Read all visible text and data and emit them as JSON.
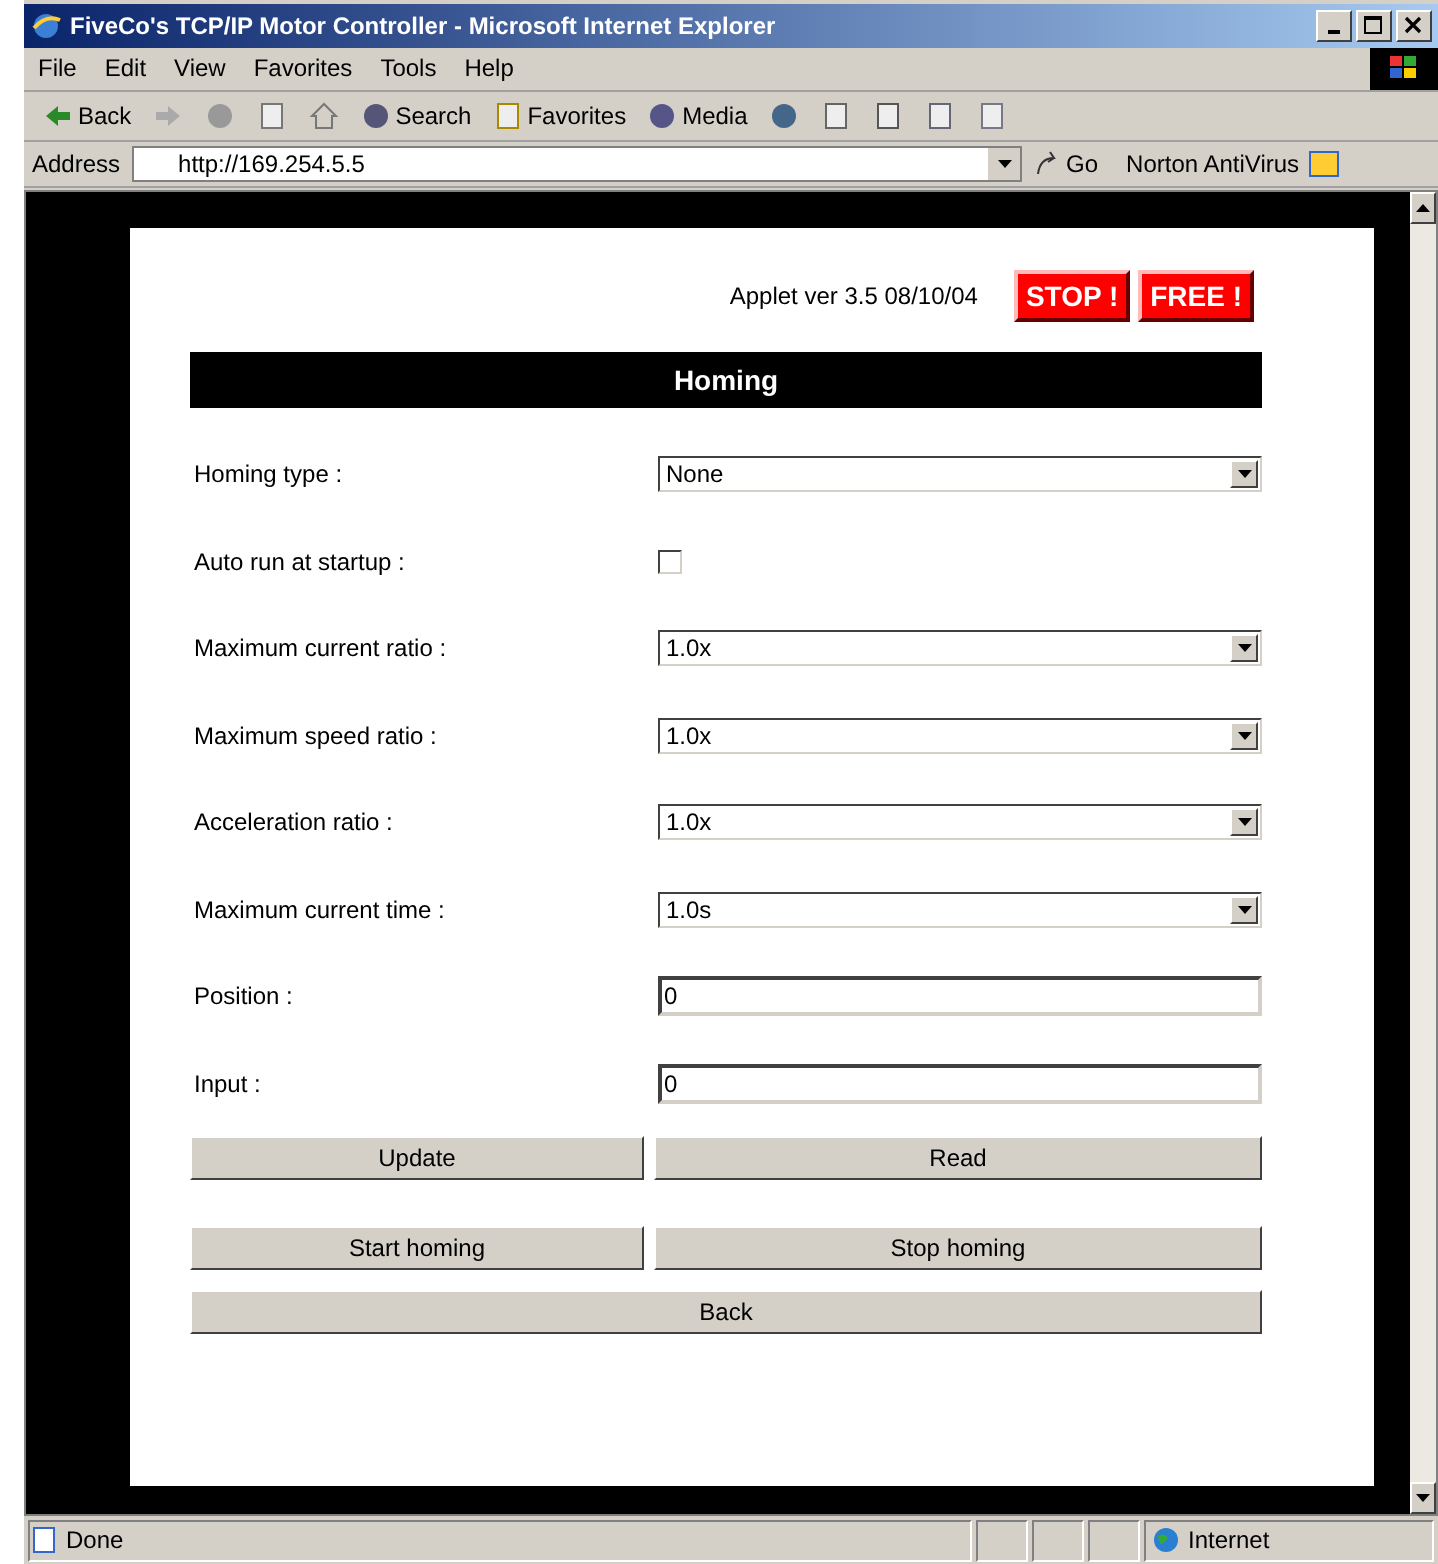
{
  "window": {
    "title": "FiveCo's TCP/IP Motor Controller - Microsoft Internet Explorer"
  },
  "menu": [
    "File",
    "Edit",
    "View",
    "Favorites",
    "Tools",
    "Help"
  ],
  "toolbar": [
    {
      "kind": "back",
      "label": "Back"
    },
    {
      "kind": "forward"
    },
    {
      "kind": "stop"
    },
    {
      "kind": "refresh"
    },
    {
      "kind": "home"
    },
    {
      "kind": "search",
      "label": "Search"
    },
    {
      "kind": "favorites",
      "label": "Favorites"
    },
    {
      "kind": "media",
      "label": "Media"
    },
    {
      "kind": "history"
    },
    {
      "kind": "mail"
    },
    {
      "kind": "print"
    },
    {
      "kind": "edit"
    },
    {
      "kind": "discuss"
    }
  ],
  "address": {
    "label": "Address",
    "value": "http://169.254.5.5",
    "go": "Go",
    "norton": "Norton AntiVirus"
  },
  "page": {
    "applet_version": "Applet ver 3.5 08/10/04",
    "emergency_buttons": [
      "STOP !",
      "FREE !"
    ],
    "heading": "Homing",
    "fields": [
      {
        "kind": "select",
        "label": "Homing type :",
        "value": "None"
      },
      {
        "kind": "checkbox",
        "label": "Auto run at startup :",
        "checked": false
      },
      {
        "kind": "select",
        "label": "Maximum current ratio :",
        "value": "1.0x"
      },
      {
        "kind": "select",
        "label": "Maximum speed ratio :",
        "value": "1.0x"
      },
      {
        "kind": "select",
        "label": "Acceleration ratio :",
        "value": "1.0x"
      },
      {
        "kind": "select",
        "label": "Maximum current time :",
        "value": "1.0s"
      },
      {
        "kind": "text",
        "label": "Position :",
        "value": "0"
      },
      {
        "kind": "text",
        "label": "Input :",
        "value": "0"
      }
    ],
    "button_rows": [
      [
        "Update",
        "Read"
      ],
      [
        "Start homing",
        "Stop homing"
      ],
      [
        "Back"
      ]
    ]
  },
  "status_bar": {
    "status": "Done",
    "zone": "Internet"
  }
}
